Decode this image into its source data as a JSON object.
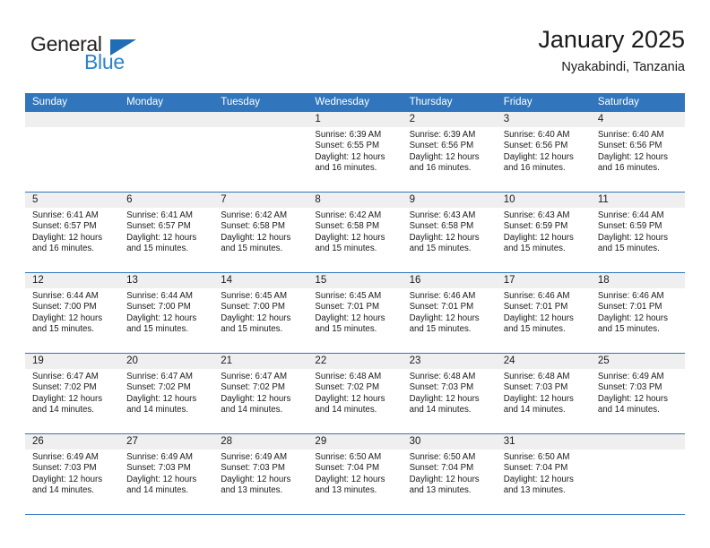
{
  "brand": {
    "name_top": "General",
    "name_bottom": "Blue",
    "triangle_color": "#1f6db4",
    "blue_color": "#2b84cc"
  },
  "header": {
    "title": "January 2025",
    "subtitle": "Nyakabindi, Tanzania"
  },
  "theme": {
    "header_blue": "#3176bc",
    "day_bar_gray": "#efefef",
    "text": "#1a1a1a"
  },
  "weekdays": [
    "Sunday",
    "Monday",
    "Tuesday",
    "Wednesday",
    "Thursday",
    "Friday",
    "Saturday"
  ],
  "weeks": [
    [
      {
        "day": "",
        "sunrise": "",
        "sunset": "",
        "daylight": "",
        "daylight2": "",
        "empty": true
      },
      {
        "day": "",
        "sunrise": "",
        "sunset": "",
        "daylight": "",
        "daylight2": "",
        "empty": true
      },
      {
        "day": "",
        "sunrise": "",
        "sunset": "",
        "daylight": "",
        "daylight2": "",
        "empty": true
      },
      {
        "day": "1",
        "sunrise": "Sunrise: 6:39 AM",
        "sunset": "Sunset: 6:55 PM",
        "daylight": "Daylight: 12 hours",
        "daylight2": "and 16 minutes."
      },
      {
        "day": "2",
        "sunrise": "Sunrise: 6:39 AM",
        "sunset": "Sunset: 6:56 PM",
        "daylight": "Daylight: 12 hours",
        "daylight2": "and 16 minutes."
      },
      {
        "day": "3",
        "sunrise": "Sunrise: 6:40 AM",
        "sunset": "Sunset: 6:56 PM",
        "daylight": "Daylight: 12 hours",
        "daylight2": "and 16 minutes."
      },
      {
        "day": "4",
        "sunrise": "Sunrise: 6:40 AM",
        "sunset": "Sunset: 6:56 PM",
        "daylight": "Daylight: 12 hours",
        "daylight2": "and 16 minutes."
      }
    ],
    [
      {
        "day": "5",
        "sunrise": "Sunrise: 6:41 AM",
        "sunset": "Sunset: 6:57 PM",
        "daylight": "Daylight: 12 hours",
        "daylight2": "and 16 minutes."
      },
      {
        "day": "6",
        "sunrise": "Sunrise: 6:41 AM",
        "sunset": "Sunset: 6:57 PM",
        "daylight": "Daylight: 12 hours",
        "daylight2": "and 15 minutes."
      },
      {
        "day": "7",
        "sunrise": "Sunrise: 6:42 AM",
        "sunset": "Sunset: 6:58 PM",
        "daylight": "Daylight: 12 hours",
        "daylight2": "and 15 minutes."
      },
      {
        "day": "8",
        "sunrise": "Sunrise: 6:42 AM",
        "sunset": "Sunset: 6:58 PM",
        "daylight": "Daylight: 12 hours",
        "daylight2": "and 15 minutes."
      },
      {
        "day": "9",
        "sunrise": "Sunrise: 6:43 AM",
        "sunset": "Sunset: 6:58 PM",
        "daylight": "Daylight: 12 hours",
        "daylight2": "and 15 minutes."
      },
      {
        "day": "10",
        "sunrise": "Sunrise: 6:43 AM",
        "sunset": "Sunset: 6:59 PM",
        "daylight": "Daylight: 12 hours",
        "daylight2": "and 15 minutes."
      },
      {
        "day": "11",
        "sunrise": "Sunrise: 6:44 AM",
        "sunset": "Sunset: 6:59 PM",
        "daylight": "Daylight: 12 hours",
        "daylight2": "and 15 minutes."
      }
    ],
    [
      {
        "day": "12",
        "sunrise": "Sunrise: 6:44 AM",
        "sunset": "Sunset: 7:00 PM",
        "daylight": "Daylight: 12 hours",
        "daylight2": "and 15 minutes."
      },
      {
        "day": "13",
        "sunrise": "Sunrise: 6:44 AM",
        "sunset": "Sunset: 7:00 PM",
        "daylight": "Daylight: 12 hours",
        "daylight2": "and 15 minutes."
      },
      {
        "day": "14",
        "sunrise": "Sunrise: 6:45 AM",
        "sunset": "Sunset: 7:00 PM",
        "daylight": "Daylight: 12 hours",
        "daylight2": "and 15 minutes."
      },
      {
        "day": "15",
        "sunrise": "Sunrise: 6:45 AM",
        "sunset": "Sunset: 7:01 PM",
        "daylight": "Daylight: 12 hours",
        "daylight2": "and 15 minutes."
      },
      {
        "day": "16",
        "sunrise": "Sunrise: 6:46 AM",
        "sunset": "Sunset: 7:01 PM",
        "daylight": "Daylight: 12 hours",
        "daylight2": "and 15 minutes."
      },
      {
        "day": "17",
        "sunrise": "Sunrise: 6:46 AM",
        "sunset": "Sunset: 7:01 PM",
        "daylight": "Daylight: 12 hours",
        "daylight2": "and 15 minutes."
      },
      {
        "day": "18",
        "sunrise": "Sunrise: 6:46 AM",
        "sunset": "Sunset: 7:01 PM",
        "daylight": "Daylight: 12 hours",
        "daylight2": "and 15 minutes."
      }
    ],
    [
      {
        "day": "19",
        "sunrise": "Sunrise: 6:47 AM",
        "sunset": "Sunset: 7:02 PM",
        "daylight": "Daylight: 12 hours",
        "daylight2": "and 14 minutes."
      },
      {
        "day": "20",
        "sunrise": "Sunrise: 6:47 AM",
        "sunset": "Sunset: 7:02 PM",
        "daylight": "Daylight: 12 hours",
        "daylight2": "and 14 minutes."
      },
      {
        "day": "21",
        "sunrise": "Sunrise: 6:47 AM",
        "sunset": "Sunset: 7:02 PM",
        "daylight": "Daylight: 12 hours",
        "daylight2": "and 14 minutes."
      },
      {
        "day": "22",
        "sunrise": "Sunrise: 6:48 AM",
        "sunset": "Sunset: 7:02 PM",
        "daylight": "Daylight: 12 hours",
        "daylight2": "and 14 minutes."
      },
      {
        "day": "23",
        "sunrise": "Sunrise: 6:48 AM",
        "sunset": "Sunset: 7:03 PM",
        "daylight": "Daylight: 12 hours",
        "daylight2": "and 14 minutes."
      },
      {
        "day": "24",
        "sunrise": "Sunrise: 6:48 AM",
        "sunset": "Sunset: 7:03 PM",
        "daylight": "Daylight: 12 hours",
        "daylight2": "and 14 minutes."
      },
      {
        "day": "25",
        "sunrise": "Sunrise: 6:49 AM",
        "sunset": "Sunset: 7:03 PM",
        "daylight": "Daylight: 12 hours",
        "daylight2": "and 14 minutes."
      }
    ],
    [
      {
        "day": "26",
        "sunrise": "Sunrise: 6:49 AM",
        "sunset": "Sunset: 7:03 PM",
        "daylight": "Daylight: 12 hours",
        "daylight2": "and 14 minutes."
      },
      {
        "day": "27",
        "sunrise": "Sunrise: 6:49 AM",
        "sunset": "Sunset: 7:03 PM",
        "daylight": "Daylight: 12 hours",
        "daylight2": "and 14 minutes."
      },
      {
        "day": "28",
        "sunrise": "Sunrise: 6:49 AM",
        "sunset": "Sunset: 7:03 PM",
        "daylight": "Daylight: 12 hours",
        "daylight2": "and 13 minutes."
      },
      {
        "day": "29",
        "sunrise": "Sunrise: 6:50 AM",
        "sunset": "Sunset: 7:04 PM",
        "daylight": "Daylight: 12 hours",
        "daylight2": "and 13 minutes."
      },
      {
        "day": "30",
        "sunrise": "Sunrise: 6:50 AM",
        "sunset": "Sunset: 7:04 PM",
        "daylight": "Daylight: 12 hours",
        "daylight2": "and 13 minutes."
      },
      {
        "day": "31",
        "sunrise": "Sunrise: 6:50 AM",
        "sunset": "Sunset: 7:04 PM",
        "daylight": "Daylight: 12 hours",
        "daylight2": "and 13 minutes."
      },
      {
        "day": "",
        "sunrise": "",
        "sunset": "",
        "daylight": "",
        "daylight2": "",
        "empty": true
      }
    ]
  ]
}
